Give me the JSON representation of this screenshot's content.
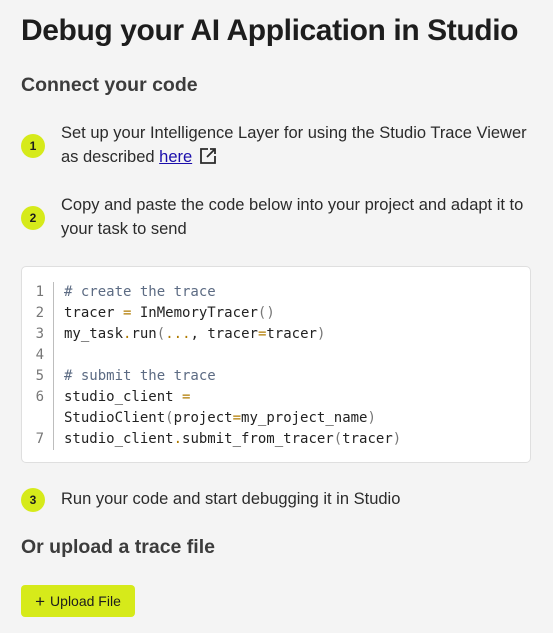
{
  "title": "Debug your AI Application in Studio",
  "connect_heading": "Connect your code",
  "steps": [
    {
      "number": "1",
      "text": "Set up your Intelligence Layer for using the Studio Trace Viewer as described ",
      "link": "here",
      "link_icon": "external-link-icon"
    },
    {
      "number": "2",
      "text": "Copy and paste the code below into your project and adapt it to your task to send"
    },
    {
      "number": "3",
      "text": "Run your code and start debugging it in Studio"
    }
  ],
  "code_lines": [
    {
      "number": "1",
      "text": "# create the trace"
    },
    {
      "number": "2",
      "text": "tracer = InMemoryTracer()"
    },
    {
      "number": "3",
      "text": "my_task.run(..., tracer=tracer)"
    },
    {
      "number": "4",
      "text": ""
    },
    {
      "number": "5",
      "text": "# submit the trace"
    },
    {
      "number": "6",
      "text": "studio_client ="
    },
    {
      "number": "",
      "text": "StudioClient(project=my_project_name)"
    },
    {
      "number": "7",
      "text": "studio_client.submit_from_tracer(tracer)"
    }
  ],
  "upload_heading": "Or upload a trace file",
  "upload_button": {
    "icon": "plus-icon",
    "label": "Upload File"
  },
  "colors": {
    "accent": "#d6ea1a",
    "link": "#1a0dab",
    "background": "#f4f4f4"
  }
}
